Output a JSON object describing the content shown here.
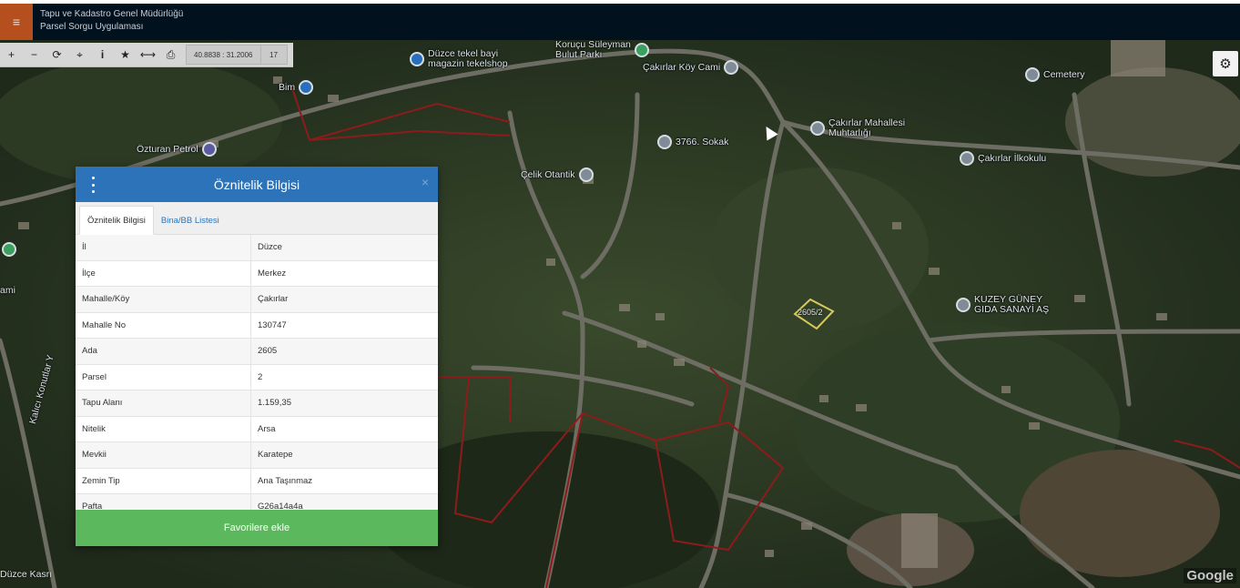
{
  "app": {
    "title_line1": "Tapu ve Kadastro Genel Müdürlüğü",
    "title_line2": "Parsel Sorgu Uygulaması",
    "menu_icon": "hamburger-icon"
  },
  "toolbar": {
    "tools": [
      {
        "name": "zoom-in-icon",
        "glyph": "+"
      },
      {
        "name": "zoom-out-icon",
        "glyph": "−"
      },
      {
        "name": "refresh-icon",
        "glyph": "⟳"
      },
      {
        "name": "locate-icon",
        "glyph": "⌖"
      },
      {
        "name": "info-icon",
        "glyph": "i"
      },
      {
        "name": "star-icon",
        "glyph": "★"
      },
      {
        "name": "measure-icon",
        "glyph": "⟷"
      },
      {
        "name": "print-icon",
        "glyph": "⎙"
      }
    ],
    "coordinates": "40.8838 : 31.2006",
    "zoom": "17"
  },
  "settings_icon": "gear-icon",
  "map": {
    "labels": [
      {
        "text": "Düzce tekel bayi\nmagazin tekelshop",
        "pin": "blue"
      },
      {
        "text": "Koruçu Süleyman\nBulut Parkı",
        "pin": "green"
      },
      {
        "text": "Çakırlar Köy Cami",
        "pin": "gray"
      },
      {
        "text": "Cemetery",
        "pin": "gray"
      },
      {
        "text": "Bim",
        "pin": "blue"
      },
      {
        "text": "Özturan Petrol",
        "pin": "purple"
      },
      {
        "text": "Çakırlar Mahallesi\nMuhtarlığı",
        "pin": "gray"
      },
      {
        "text": "3766. Sokak",
        "pin": "gray"
      },
      {
        "text": "Çakırlar İlkokulu",
        "pin": "gray"
      },
      {
        "text": "Çelik Otantik",
        "pin": "gray"
      },
      {
        "text": "KUZEY GÜNEY\nGIDA SANAYİ AŞ",
        "pin": "gray"
      },
      {
        "text": "ami",
        "pin": "none"
      },
      {
        "text": "Kalıcı Konutlar Y",
        "pin": "none"
      }
    ],
    "parcel_label": "2605/2",
    "corner_label": "Düzce Kasrı",
    "google": "Google"
  },
  "panel": {
    "title": "Öznitelik Bilgisi",
    "close": "×",
    "tabs": [
      "Öznitelik Bilgisi",
      "Bina/BB Listesi"
    ],
    "rows": [
      {
        "key": "İl",
        "value": "Düzce"
      },
      {
        "key": "İlçe",
        "value": "Merkez"
      },
      {
        "key": "Mahalle/Köy",
        "value": "Çakırlar"
      },
      {
        "key": "Mahalle No",
        "value": "130747"
      },
      {
        "key": "Ada",
        "value": "2605"
      },
      {
        "key": "Parsel",
        "value": "2"
      },
      {
        "key": "Tapu Alanı",
        "value": "1.159,35"
      },
      {
        "key": "Nitelik",
        "value": "Arsa"
      },
      {
        "key": "Mevkii",
        "value": "Karatepe"
      },
      {
        "key": "Zemin Tip",
        "value": "Ana Taşınmaz"
      },
      {
        "key": "Pafta",
        "value": "G26a14a4a"
      }
    ],
    "favorite_button": "Favorilere ekle"
  },
  "colors": {
    "topbar": "#02111e",
    "menu": "#b5501e",
    "panel_header": "#2c73b9",
    "favorite": "#5cb85c",
    "parcel_line": "#8e1b1b"
  }
}
